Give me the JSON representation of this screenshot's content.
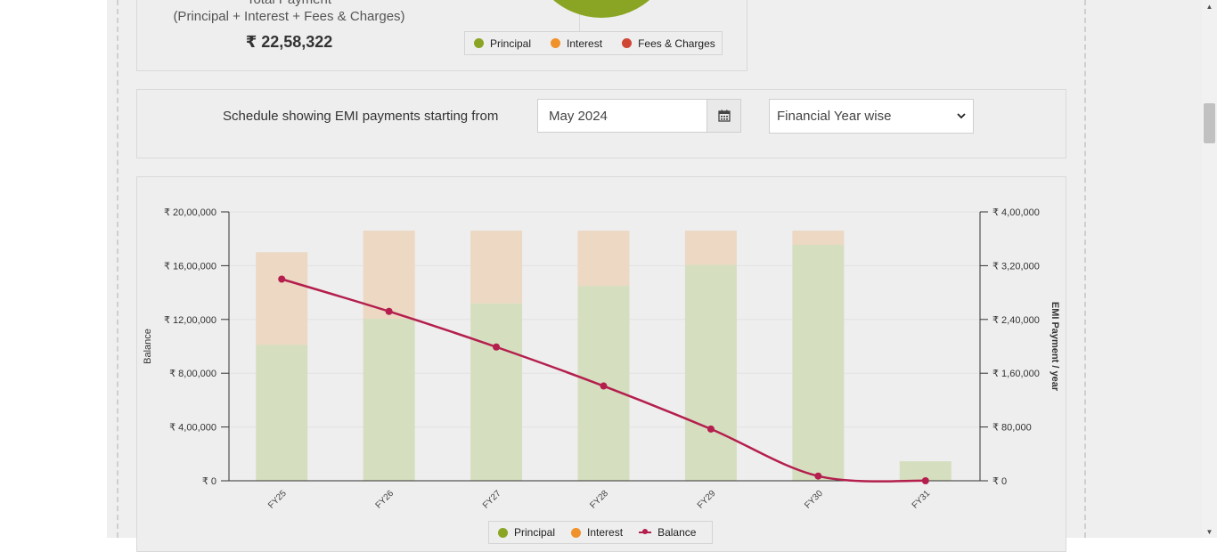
{
  "summary": {
    "total_label_line1": "Total Payment",
    "total_label_line2": "(Principal + Interest + Fees & Charges)",
    "total_value": "₹ 22,58,322",
    "pie_legend": [
      {
        "label": "Principal",
        "color": "#8aa523"
      },
      {
        "label": "Interest",
        "color": "#f0922c"
      },
      {
        "label": "Fees & Charges",
        "color": "#d04635"
      }
    ]
  },
  "schedule": {
    "label": "Schedule showing EMI payments starting from",
    "month_value": "May 2024",
    "period_selected": "Financial Year wise"
  },
  "chart_data": {
    "type": "bar",
    "categories": [
      "FY25",
      "FY26",
      "FY27",
      "FY28",
      "FY29",
      "FY30",
      "FY31"
    ],
    "series": [
      {
        "name": "Principal",
        "axis": "right",
        "color": "#d5dfbf",
        "values": [
          202000,
          241000,
          264000,
          290000,
          321000,
          351000,
          29000
        ]
      },
      {
        "name": "Interest",
        "axis": "right",
        "color": "#ecd8c3",
        "values": [
          138000,
          131000,
          108000,
          82000,
          51000,
          21000,
          0
        ]
      },
      {
        "name": "Balance",
        "axis": "left",
        "type": "line",
        "color": "#b41f4d",
        "values": [
          1500000,
          1260000,
          995000,
          705000,
          385000,
          35000,
          0
        ]
      }
    ],
    "ylabel_left": "Balance",
    "ylabel_right": "EMI Payment / year",
    "ylim_left": [
      0,
      2000000
    ],
    "ylim_right": [
      0,
      400000
    ],
    "yticks_left": [
      "₹ 0",
      "₹ 4,00,000",
      "₹ 8,00,000",
      "₹ 12,00,000",
      "₹ 16,00,000",
      "₹ 20,00,000"
    ],
    "yticks_right": [
      "₹ 0",
      "₹ 80,000",
      "₹ 1,60,000",
      "₹ 2,40,000",
      "₹ 3,20,000",
      "₹ 4,00,000"
    ],
    "legend": [
      {
        "label": "Principal",
        "color": "#8aa523"
      },
      {
        "label": "Interest",
        "color": "#f0922c"
      },
      {
        "label": "Balance",
        "color": "#b41f4d"
      }
    ]
  }
}
